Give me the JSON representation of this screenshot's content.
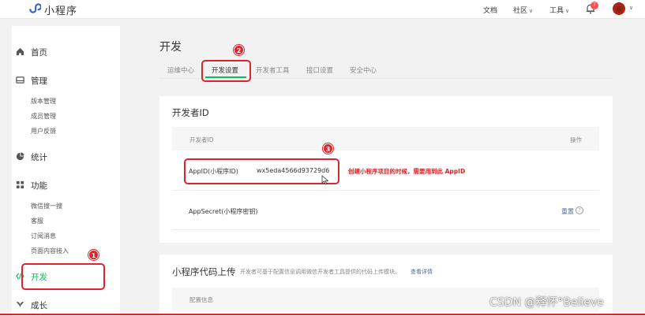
{
  "colors": {
    "accent": "#07c160",
    "annotation": "#d9252b",
    "link": "#576b95"
  },
  "header": {
    "app_name": "小程序",
    "logo_icon": "miniprogram-logo-icon",
    "nav": {
      "docs": "文档",
      "community": "社区",
      "tools": "工具"
    },
    "notification_badge": "7",
    "bell_icon": "bell-icon",
    "avatar_icon": "avatar"
  },
  "sidebar": {
    "groups": [
      {
        "label": "首页",
        "icon": "home-icon"
      },
      {
        "label": "管理",
        "icon": "management-icon",
        "items": [
          "版本管理",
          "成员管理",
          "用户反馈"
        ]
      },
      {
        "label": "统计",
        "icon": "pie-chart-icon"
      },
      {
        "label": "功能",
        "icon": "grid-icon",
        "items": [
          "微信搜一搜",
          "客服",
          "订阅消息",
          "页面内容接入"
        ]
      },
      {
        "label": "开发",
        "icon": "code-icon",
        "active": true
      },
      {
        "label": "成长",
        "icon": "growth-icon"
      }
    ]
  },
  "main": {
    "title": "开发",
    "tabs": [
      "运维中心",
      "开发设置",
      "开发者工具",
      "接口设置",
      "安全中心"
    ],
    "active_tab": "开发设置",
    "developer_id_card": {
      "title": "开发者ID",
      "columns": {
        "id": "开发者ID",
        "action": "操作"
      },
      "appid_label": "AppID(小程序ID)",
      "appid_value": "wx5eda4566d93729d6",
      "appsecret_label": "AppSecret(小程序密钥)",
      "appsecret_action": "重置"
    },
    "upload_card": {
      "title": "小程序代码上传",
      "description": "开发者可基于配置信息调用微信开发者工具提供的代码上传模块。",
      "link": "查看详情",
      "column": "配置信息"
    }
  },
  "annotations": {
    "markers": [
      "1",
      "2",
      "3"
    ],
    "note": "创建小程序项目的时候，需要用到此 AppID"
  },
  "watermark": "CSDN @释怀°Believe"
}
